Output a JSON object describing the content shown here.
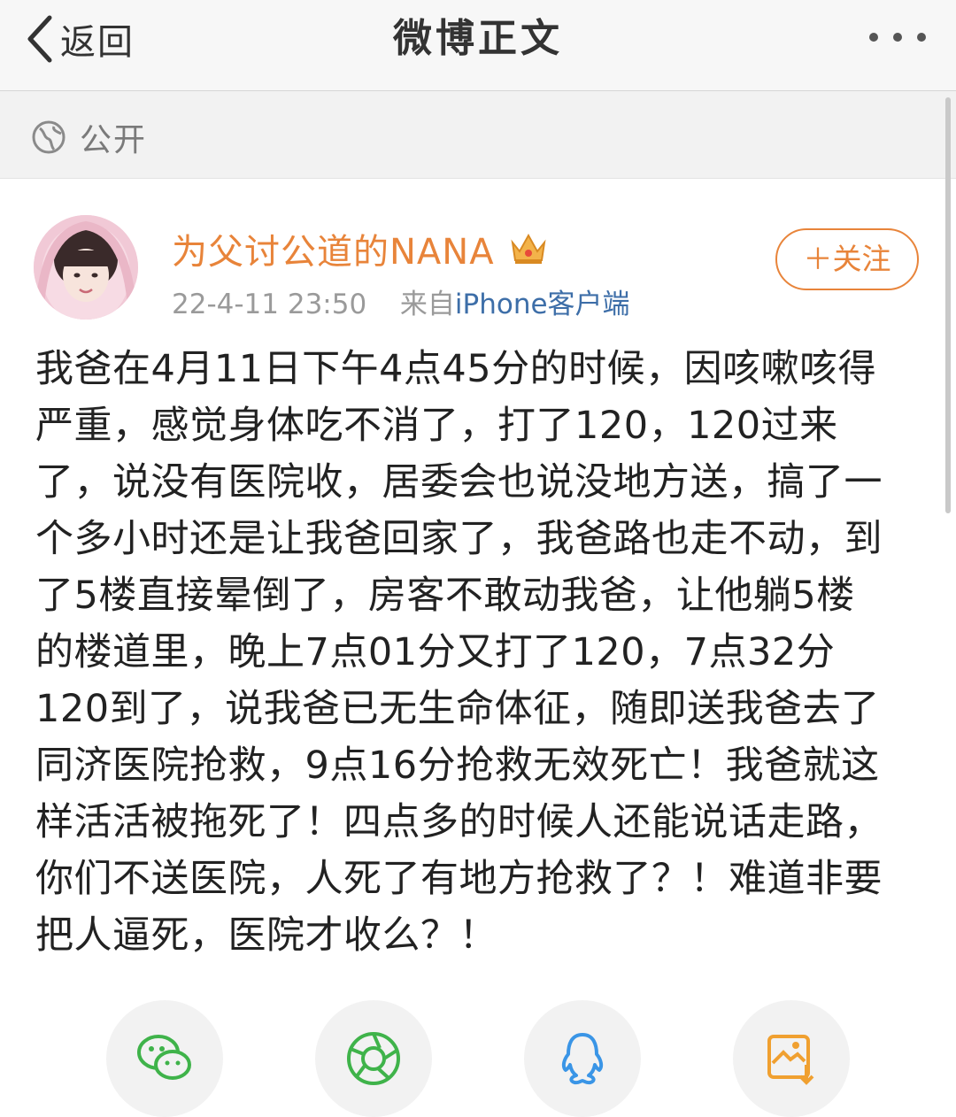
{
  "header": {
    "back_label": "返回",
    "title": "微博正文",
    "more_icon": "more-dots-icon"
  },
  "privacy": {
    "icon": "globe-icon",
    "label": "公开"
  },
  "post": {
    "author_name": "为父讨公道的NANA",
    "author_badge": "crown-icon",
    "timestamp": "22-4-11 23:50",
    "source_prefix": "来自",
    "source_client": "iPhone客户端",
    "follow_label": "＋关注",
    "text": "我爸在4月11日下午4点45分的时候，因咳嗽咳得\n严重，感觉身体吃不消了，打了120，120过来\n了，说没有医院收，居委会也说没地方送，搞了一\n个多小时还是让我爸回家了，我爸路也走不动，到\n了5楼直接晕倒了，房客不敢动我爸，让他躺5楼\n的楼道里，晚上7点01分又打了120，7点32分\n120到了，说我爸已无生命体征，随即送我爸去了\n同济医院抢救，9点16分抢救无效死亡！我爸就这\n样活活被拖死了！四点多的时候人还能说话走路，\n你们不送医院，人死了有地方抢救了？！难道非要\n把人逼死，医院才收么？！"
  },
  "share": {
    "icons": [
      "wechat-icon",
      "moments-icon",
      "qq-icon",
      "save-image-icon"
    ],
    "colors": {
      "wechat": "#3fb34a",
      "moments": "#3fb34a",
      "qq": "#3a95e6",
      "save": "#f0a030"
    }
  },
  "colors": {
    "accent": "#e8843a",
    "link": "#3d6ea8"
  }
}
